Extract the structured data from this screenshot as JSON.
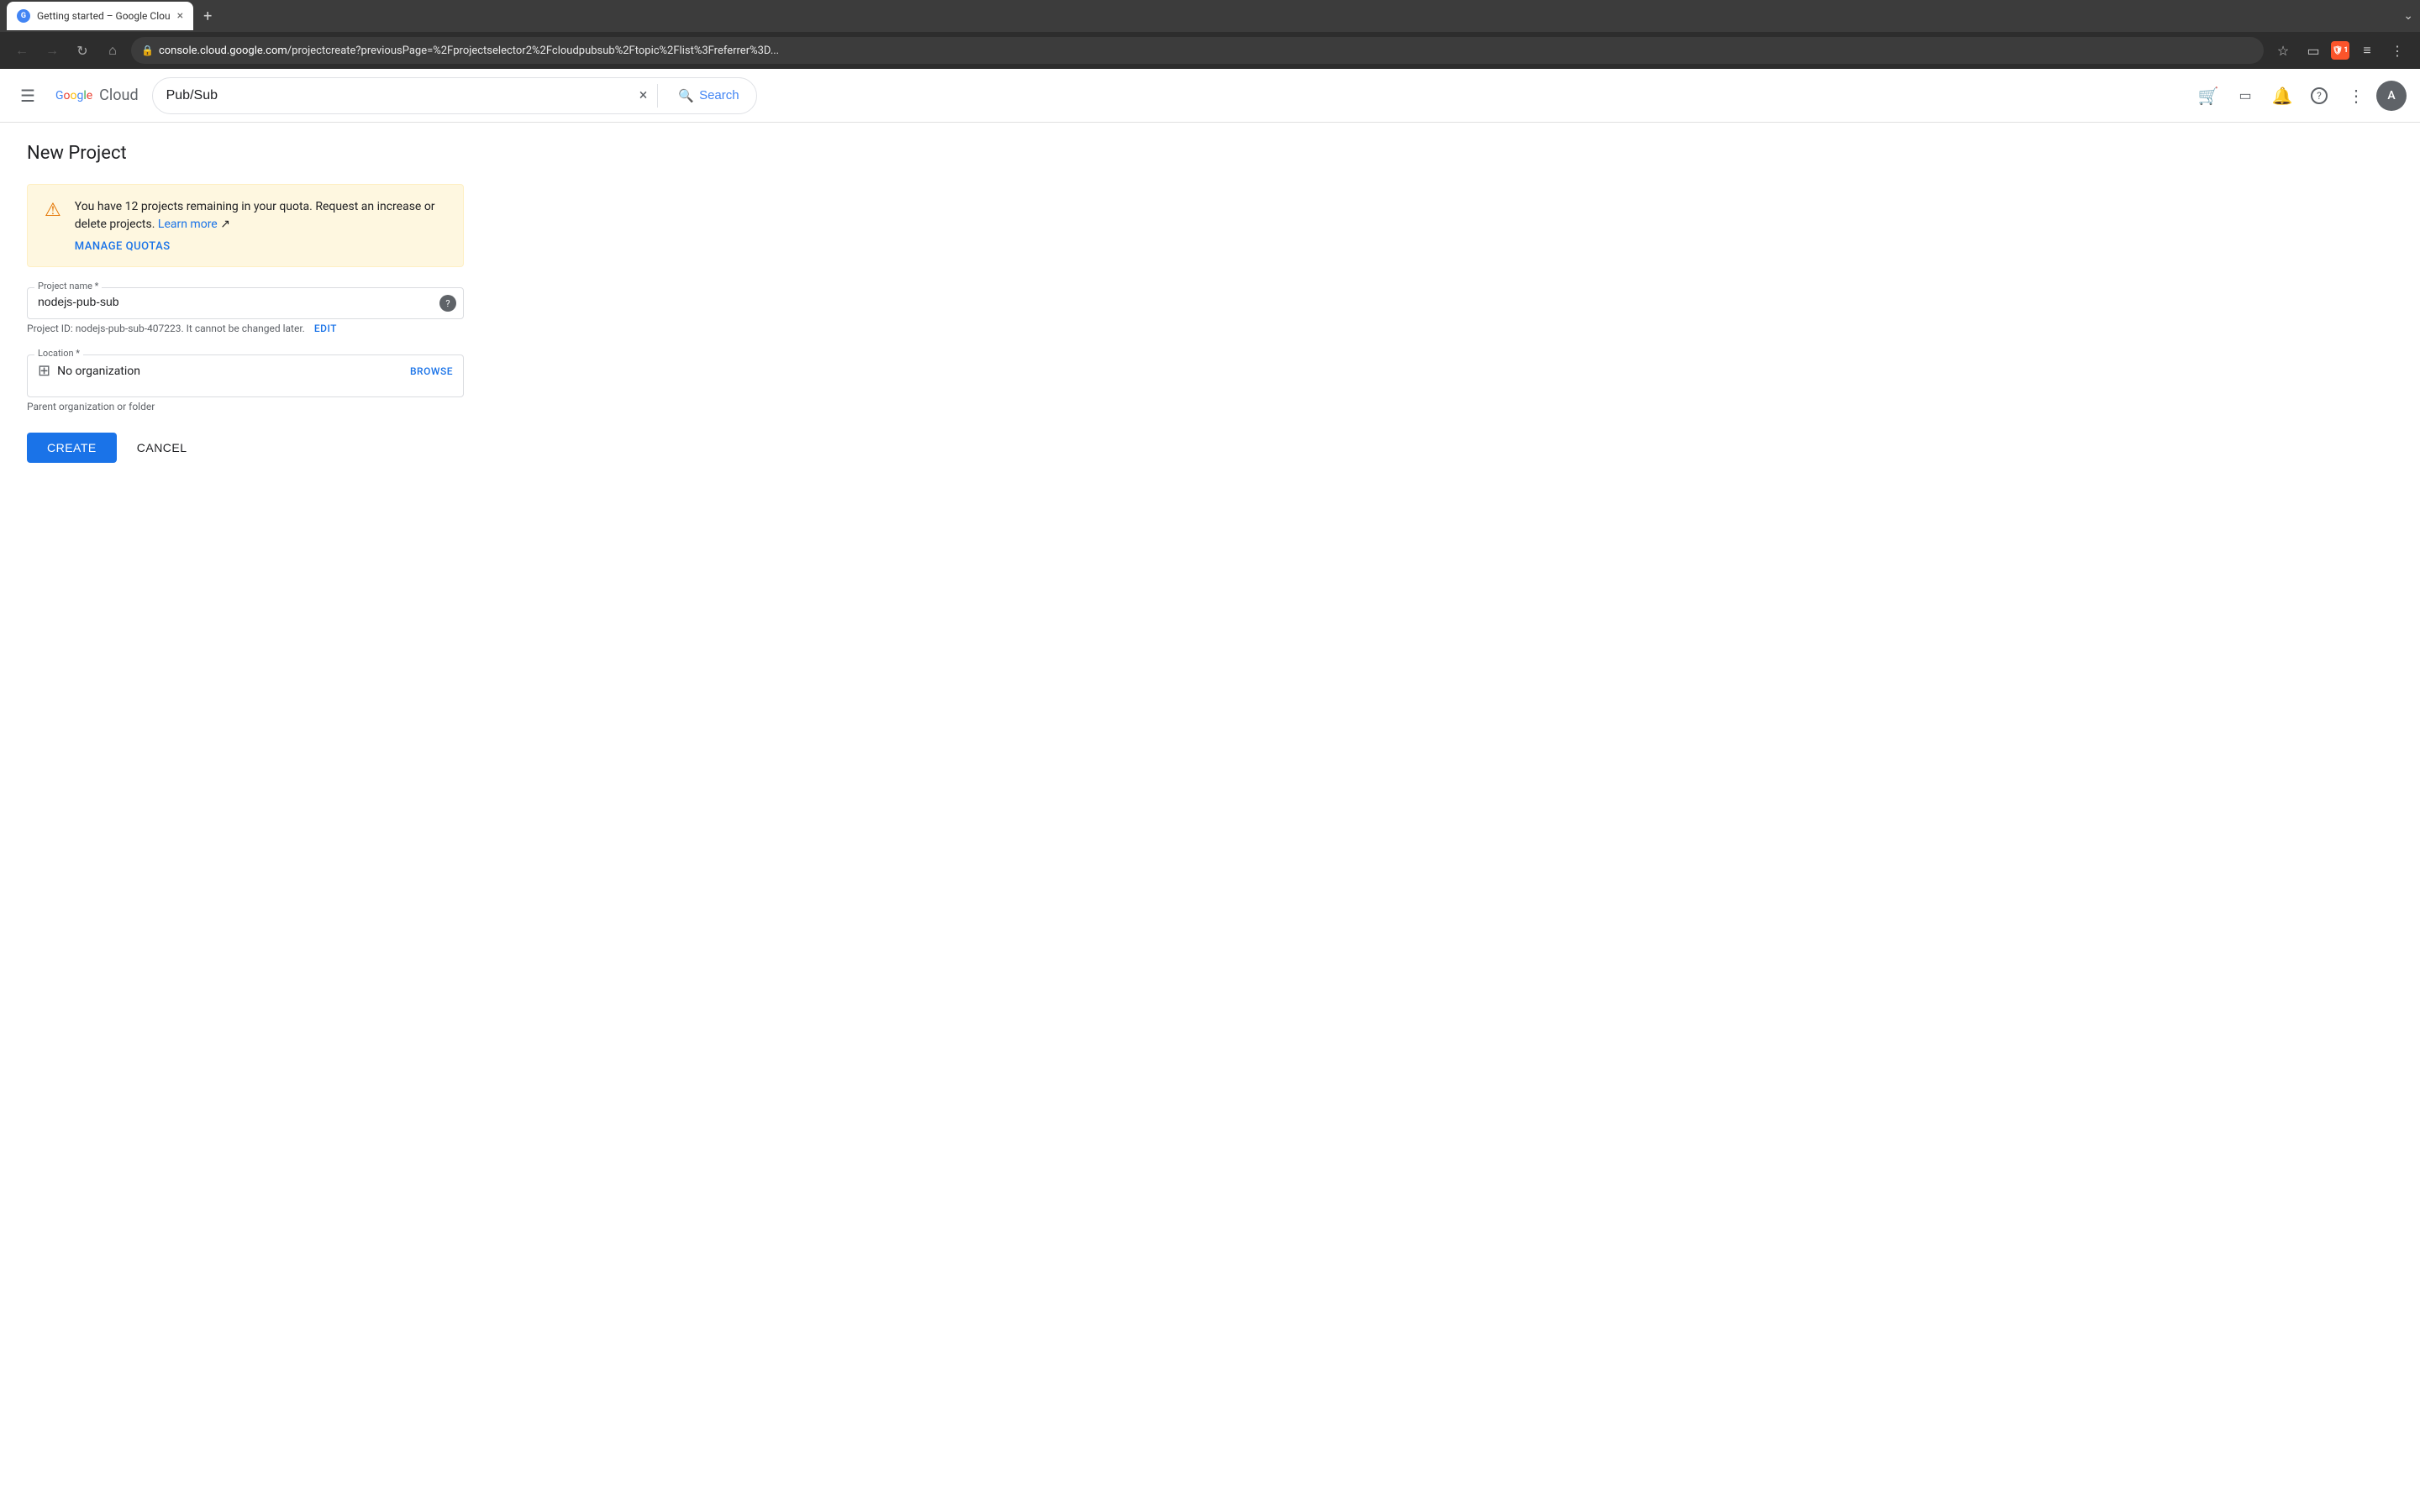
{
  "browser": {
    "tab": {
      "title": "Getting started – Google Clou",
      "favicon": "G",
      "close": "×"
    },
    "new_tab_label": "+",
    "more_tabs_label": "⌄",
    "nav": {
      "back": "←",
      "forward": "→",
      "reload": "↻",
      "home": "⌂"
    },
    "address": {
      "lock": "🔒",
      "url_prefix": "console.cloud.google.com",
      "url_suffix": "/projectcreate?previousPage=%2Fprojectselector2%2Fcloudpubsub%2Ftopic%2Flist%3Freferrer%3D..."
    },
    "actions": {
      "bookmark": "☆",
      "cast": "▭",
      "brave_shield": "B",
      "brave_count": "1",
      "reader": "≡",
      "menu": "⋮"
    }
  },
  "header": {
    "menu_icon": "☰",
    "logo_google": "Google",
    "logo_cloud": "Cloud",
    "search_placeholder": "Pub/Sub",
    "search_value": "Pub/Sub",
    "search_clear": "×",
    "search_button": "Search",
    "icons": {
      "marketplace": "🛒",
      "cloud_shell": "▭",
      "notifications": "🔔",
      "help": "?",
      "more": "⋮"
    },
    "avatar_label": "A"
  },
  "page": {
    "title": "New Project",
    "warning": {
      "text": "You have 12 projects remaining in your quota. Request an increase or delete projects.",
      "learn_more_label": "Learn more",
      "manage_quotas_label": "MANAGE QUOTAS"
    },
    "form": {
      "project_name_label": "Project name",
      "project_name_required": true,
      "project_name_value": "nodejs-pub-sub",
      "project_id_hint": "Project ID: nodejs-pub-sub-407223.  It cannot be changed later.",
      "edit_label": "EDIT",
      "location_label": "Location",
      "location_required": true,
      "location_value": "No organization",
      "browse_label": "BROWSE",
      "location_hint": "Parent organization or folder",
      "create_button": "CREATE",
      "cancel_button": "CANCEL"
    }
  }
}
